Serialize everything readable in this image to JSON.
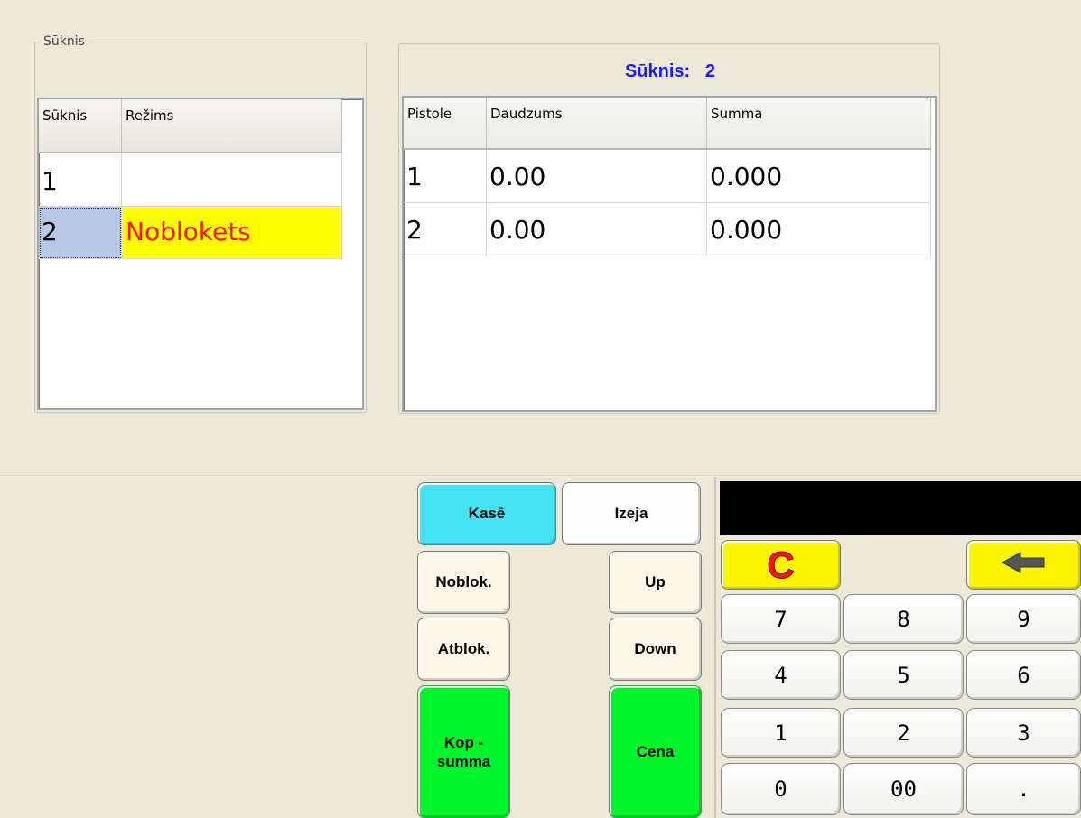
{
  "left_group": {
    "legend": "Sūknis",
    "columns": [
      "Sūknis",
      "Režims"
    ],
    "rows": [
      {
        "pump": "1",
        "mode": ""
      },
      {
        "pump": "2",
        "mode": "Noblokets"
      }
    ]
  },
  "right_panel": {
    "title_label": "Sūknis:",
    "title_value": "2",
    "columns": [
      "Pistole",
      "Daudzums",
      "Summa"
    ],
    "rows": [
      {
        "nozzle": "1",
        "qty": "0.00",
        "sum": "0.000"
      },
      {
        "nozzle": "2",
        "qty": "0.00",
        "sum": "0.000"
      }
    ]
  },
  "buttons": {
    "kase": "Kasē",
    "izeja": "Izeja",
    "noblok": "Noblok.",
    "up": "Up",
    "atblok": "Atblok.",
    "down": "Down",
    "kop_summa_line1": "Kop -",
    "kop_summa_line2": "summa",
    "cena": "Cena"
  },
  "keypad": {
    "display_value": "",
    "clear": "C",
    "backspace_icon": "left-arrow-icon",
    "keys": [
      "7",
      "8",
      "9",
      "4",
      "5",
      "6",
      "1",
      "2",
      "3",
      "0",
      "00",
      "."
    ]
  },
  "colors": {
    "title_blue": "#1a1aff",
    "blocked_text": "#ff1010",
    "blocked_bg": "#ffff00",
    "selected_cell": "#b7c9e6",
    "cyan": "#44e3f3",
    "green": "#00f52a",
    "yellow": "#fbf600"
  }
}
